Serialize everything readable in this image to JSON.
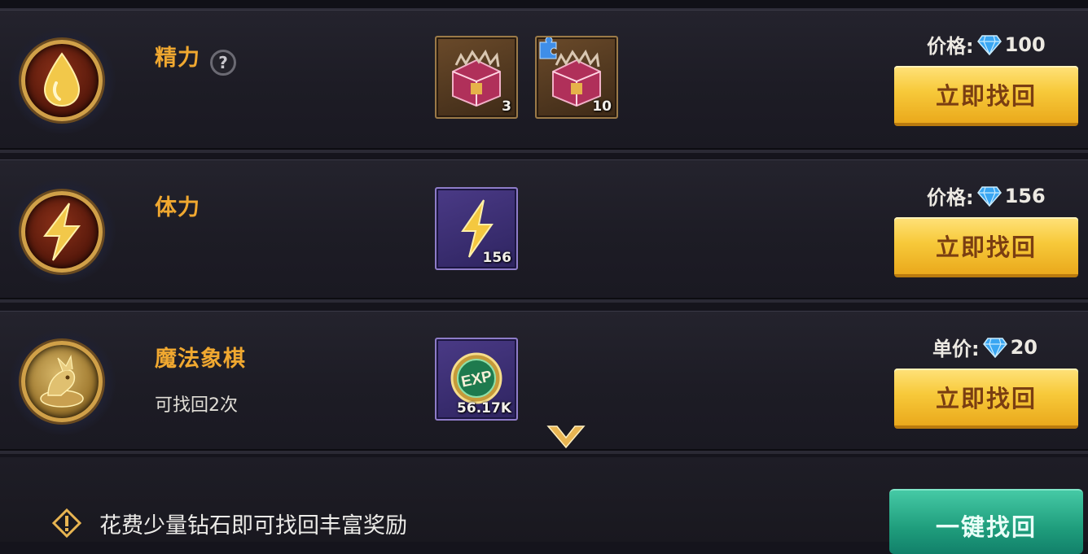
{
  "rows": [
    {
      "name": "精力",
      "price_label": "价格:",
      "price": "100",
      "button": "立即找回",
      "items": [
        {
          "icon": "treasure-chest-icon",
          "count": "3"
        },
        {
          "icon": "treasure-chest-fragment-icon",
          "count": "10"
        }
      ]
    },
    {
      "name": "体力",
      "price_label": "价格:",
      "price": "156",
      "button": "立即找回",
      "items": [
        {
          "icon": "lightning-bolt-icon",
          "count": "156"
        }
      ]
    },
    {
      "name": "魔法象棋",
      "subtitle": "可找回2次",
      "price_label": "单价:",
      "price": "20",
      "button": "立即找回",
      "items": [
        {
          "icon": "exp-coin-icon",
          "count": "56.17K"
        }
      ]
    }
  ],
  "footer": {
    "tip": "花费少量钻石即可找回丰富奖励",
    "button": "一键找回"
  },
  "colors": {
    "name": "#f0a830",
    "gold_button": "#f7c93a",
    "green_button": "#1f9d7c"
  }
}
